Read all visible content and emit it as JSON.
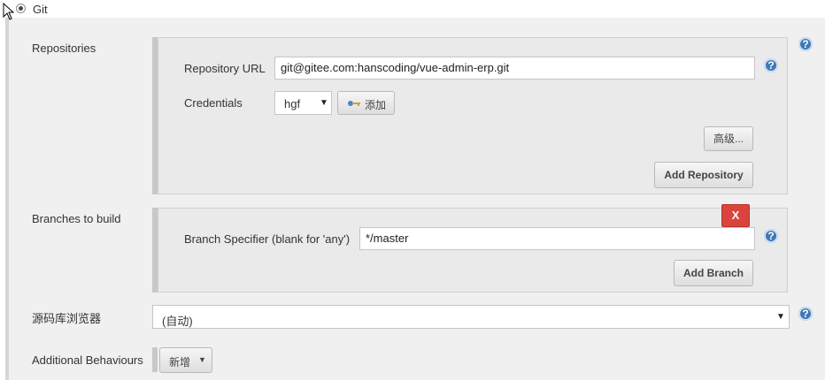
{
  "scm": {
    "option_label": "Git",
    "selected": true
  },
  "repositories": {
    "label": "Repositories",
    "url_label": "Repository URL",
    "url_value": "git@gitee.com:hanscoding/vue-admin-erp.git",
    "credentials_label": "Credentials",
    "credentials_value": "hgf",
    "add_credentials_label": "添加",
    "advanced_label": "高级...",
    "add_repository_label": "Add Repository"
  },
  "branches": {
    "label": "Branches to build",
    "delete_label": "X",
    "specifier_label": "Branch Specifier (blank for 'any')",
    "specifier_value": "*/master",
    "add_branch_label": "Add Branch"
  },
  "source_browser": {
    "label": "源码库浏览器",
    "value": "(自动)"
  },
  "behaviours": {
    "label": "Additional Behaviours",
    "add_label": "新增"
  },
  "icons": {
    "help": "help-icon",
    "key": "key-icon",
    "cursor": "mouse-cursor-icon"
  },
  "colors": {
    "help": "#3f78b7",
    "delete": "#d9443c"
  }
}
